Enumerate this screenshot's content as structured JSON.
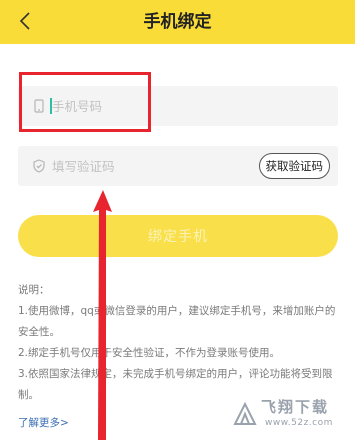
{
  "header": {
    "title": "手机绑定",
    "back_icon": "chevron-left-icon"
  },
  "form": {
    "phone": {
      "placeholder": "手机号码",
      "icon": "phone-icon",
      "value": ""
    },
    "code": {
      "placeholder": "填写验证码",
      "icon": "shield-icon",
      "value": ""
    },
    "get_code_label": "获取验证码",
    "submit_label": "绑定手机"
  },
  "notes": {
    "title": "说明：",
    "items": [
      "1.使用微博，qq或微信登录的用户，建议绑定手机号，来增加账户的安全性。",
      "2.绑定手机号仅用于安全性验证，不作为登录账号使用。",
      "3.依照国家法律规定，未完成手机号绑定的用户，评论功能将受到限制。"
    ]
  },
  "learn_more": "了解更多>",
  "watermark": {
    "text": "飞翔下载",
    "url": "www.52z.com"
  },
  "colors": {
    "accent": "#f9dc38",
    "button": "#f9e04a",
    "link": "#3b6fb6",
    "annotation": "#e8242e"
  }
}
